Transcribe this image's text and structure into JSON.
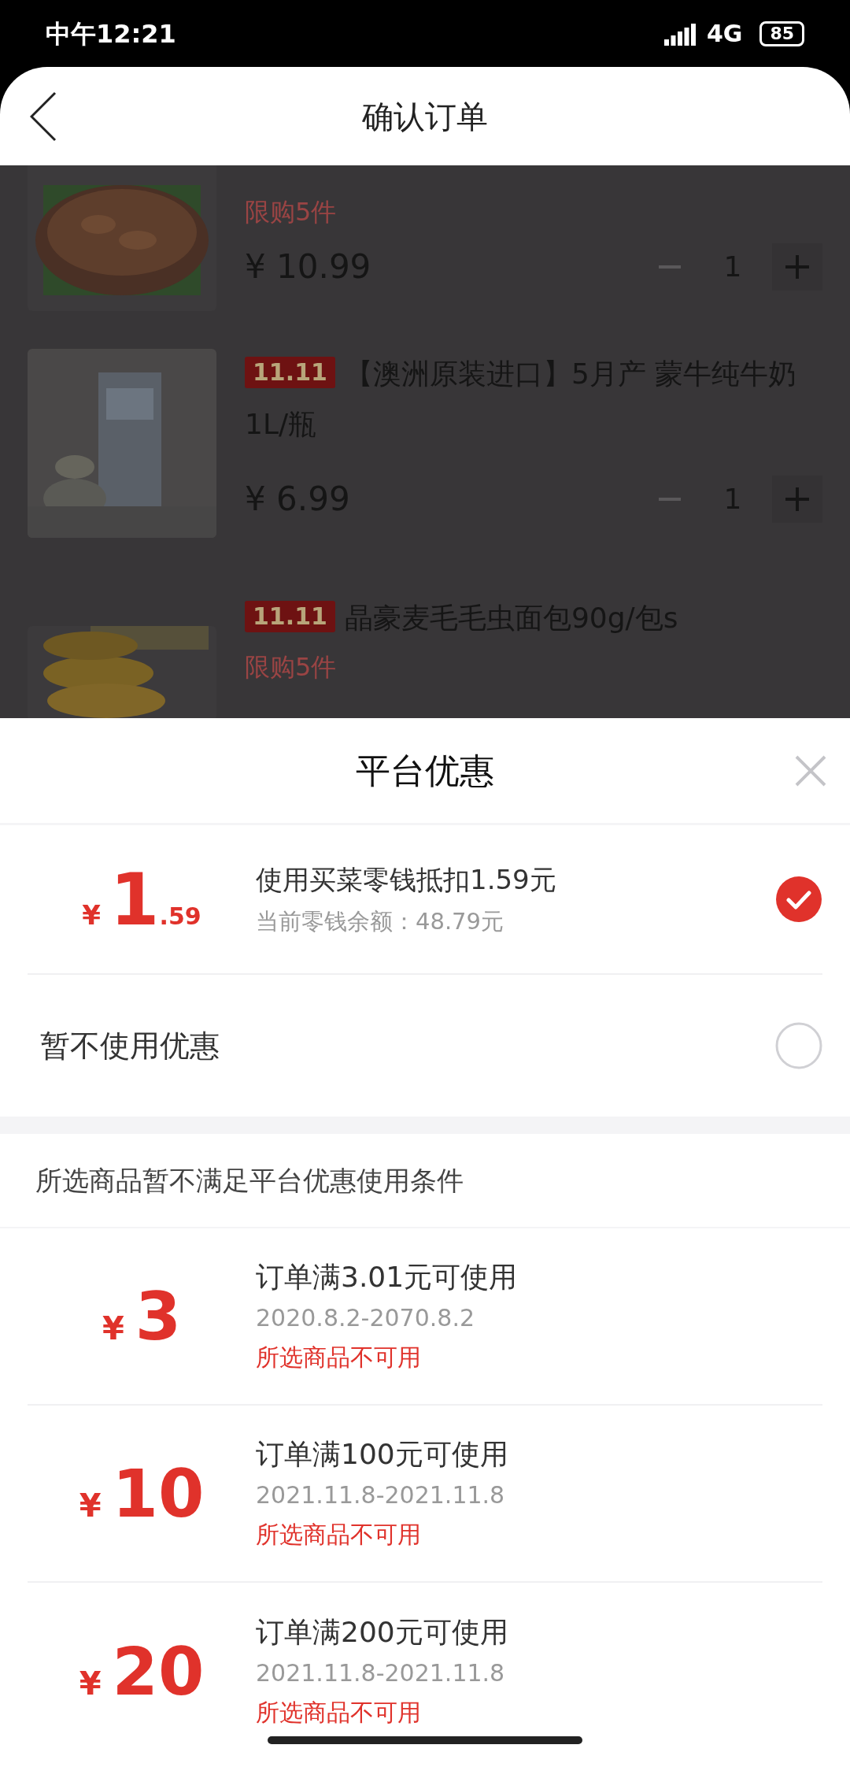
{
  "status_bar": {
    "time": "中午12:21",
    "network": "4G",
    "battery": "85"
  },
  "header": {
    "title": "确认订单"
  },
  "products": [
    {
      "limit": "限购5件",
      "currency": "¥",
      "price": "10.99",
      "quantity": "1"
    },
    {
      "tag": "11.11",
      "title": "【澳洲原装进口】5月产 蒙牛纯牛奶1L/瓶",
      "currency": "¥",
      "price": "6.99",
      "quantity": "1"
    },
    {
      "tag": "11.11",
      "title": "晶豪麦毛毛虫面包90g/包s",
      "limit": "限购5件"
    }
  ],
  "sheet": {
    "title": "平台优惠",
    "options": [
      {
        "kind": "balance",
        "currency": "¥",
        "amount": "1",
        "decimals": ".59",
        "title": "使用买菜零钱抵扣1.59元",
        "subtitle": "当前零钱余额：48.79元",
        "selected": true
      },
      {
        "kind": "none",
        "label": "暂不使用优惠",
        "selected": false
      }
    ],
    "notice": "所选商品暂不满足平台优惠使用条件",
    "coupons": [
      {
        "currency": "¥",
        "amount": "3",
        "condition": "订单满3.01元可使用",
        "dates": "2020.8.2-2070.8.2",
        "status": "所选商品不可用"
      },
      {
        "currency": "¥",
        "amount": "10",
        "condition": "订单满100元可使用",
        "dates": "2021.11.8-2021.11.8",
        "status": "所选商品不可用"
      },
      {
        "currency": "¥",
        "amount": "20",
        "condition": "订单满200元可使用",
        "dates": "2021.11.8-2021.11.8",
        "status": "所选商品不可用"
      }
    ]
  }
}
